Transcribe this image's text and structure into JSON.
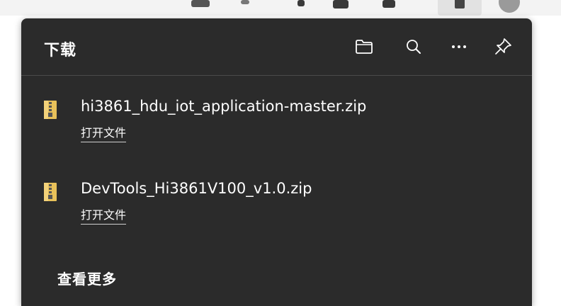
{
  "panel": {
    "title": "下载",
    "background": "#2b2b2b",
    "icons": [
      "folder-icon",
      "search-icon",
      "more-icon",
      "pin-icon"
    ]
  },
  "downloads": [
    {
      "file_name": "hi3861_hdu_iot_application-master.zip",
      "open_label": "打开文件",
      "icon": "zip-file-icon"
    },
    {
      "file_name": "DevTools_Hi3861V100_v1.0.zip",
      "open_label": "打开文件",
      "icon": "zip-file-icon"
    }
  ],
  "footer": {
    "see_more_label": "查看更多"
  }
}
